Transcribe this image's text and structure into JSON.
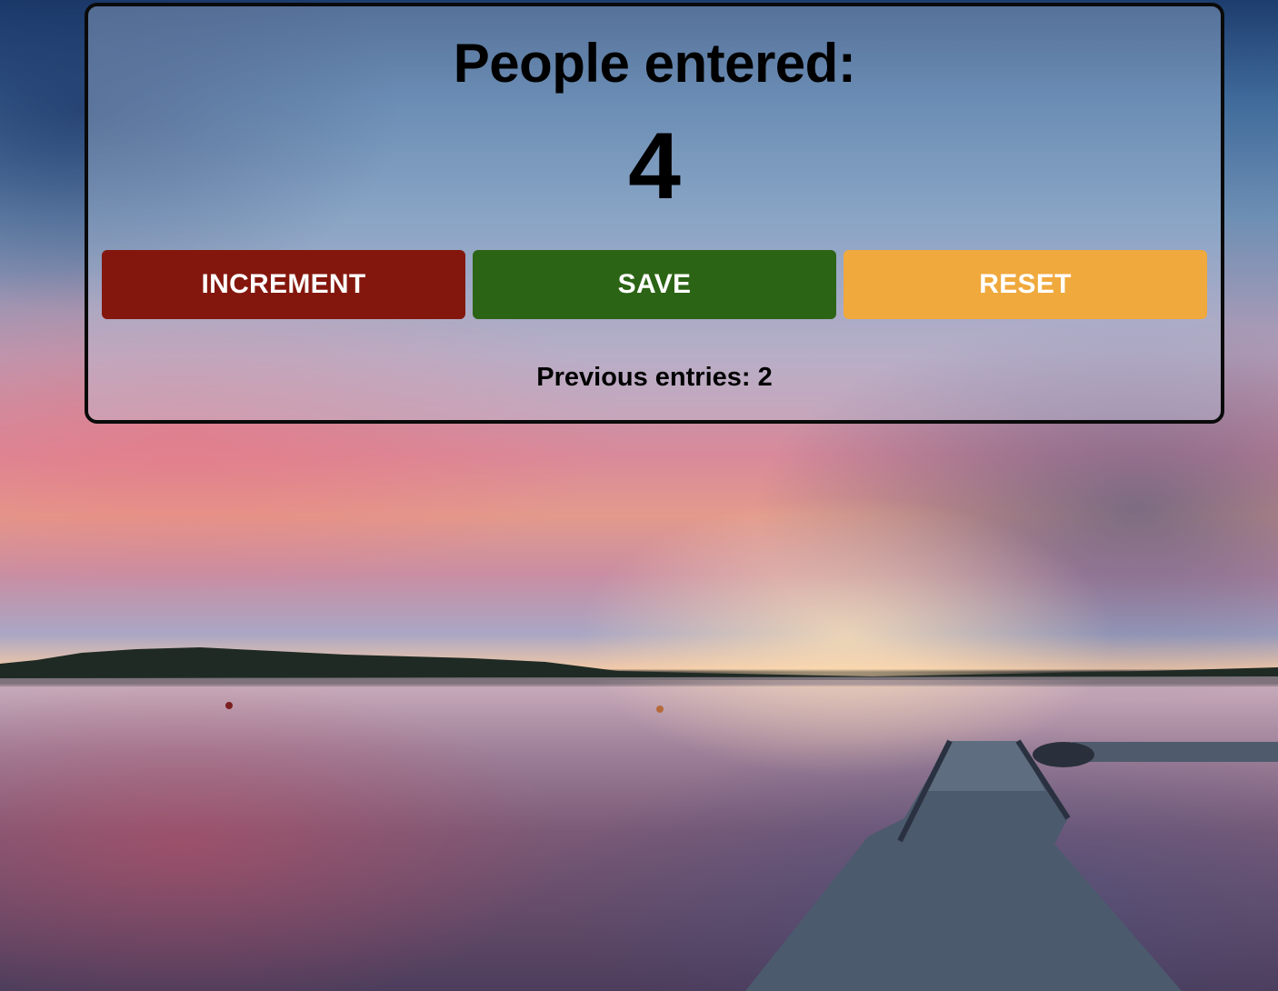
{
  "counter": {
    "title": "People entered:",
    "count": "4",
    "previous_entries": "Previous entries: 2"
  },
  "buttons": {
    "increment_label": "INCREMENT",
    "save_label": "SAVE",
    "reset_label": "RESET"
  },
  "colors": {
    "increment": "#84170d",
    "save": "#2c6415",
    "reset": "#f0a93d",
    "card_border": "#0a0a0a"
  },
  "background": {
    "scene": "sunset-lake-with-pier-photo"
  }
}
